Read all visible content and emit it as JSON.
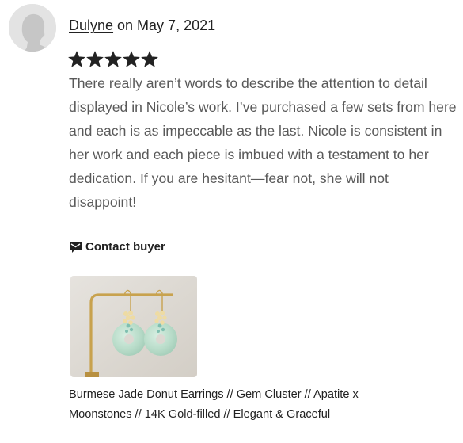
{
  "review": {
    "username": "Dulyne",
    "date_text": " on May 7, 2021",
    "rating": 5,
    "rating_max": 5,
    "text": "There really aren’t words to describe the attention to detail displayed in Nicole’s work. I’ve purchased a few sets from here and each is as impeccable as the last. Nicole is consistent in her work and each piece is imbued with a testament to her dedication. If you are hesitant—fear not, she will not disappoint!",
    "contact_label": "Contact buyer",
    "item_title": "Burmese Jade Donut Earrings // Gem Cluster // Apatite x Moonstones // 14K Gold-filled // Elegant & Graceful"
  },
  "icons": {
    "avatar": "default-user-avatar-icon",
    "star": "star-icon",
    "contact": "message-icon"
  },
  "colors": {
    "text_primary": "#222222",
    "text_body": "#595959",
    "star": "#222222",
    "avatar_bg": "#e3e3e3",
    "avatar_figure": "#c4c4c4",
    "photo_bg": "#ddd9d2",
    "gold": "#c8a24e",
    "jade": "#b9dcc8"
  }
}
